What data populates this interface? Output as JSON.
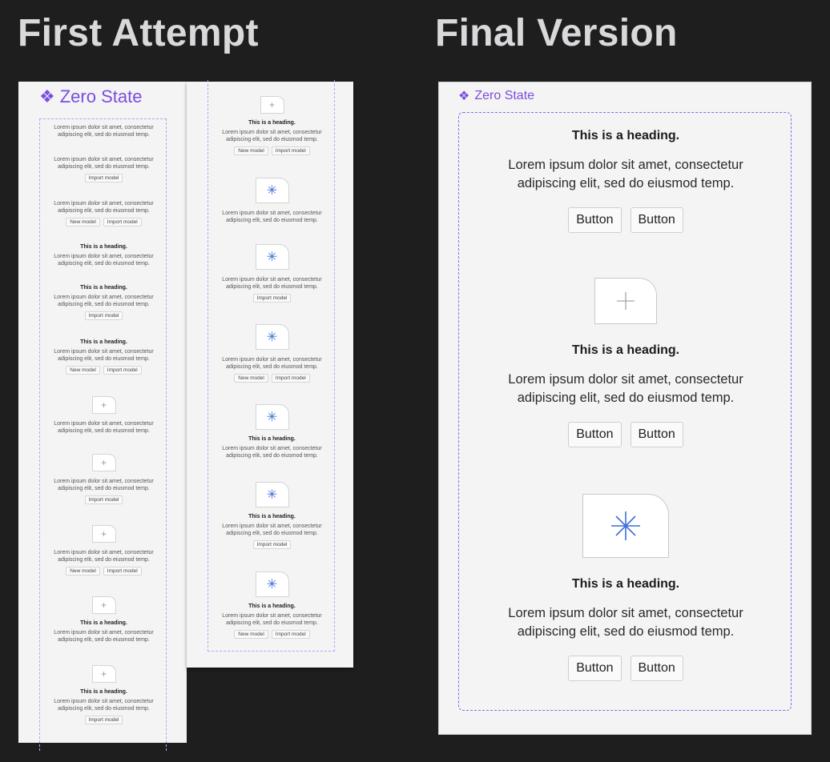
{
  "titles": {
    "left": "First Attempt",
    "right": "Final Version"
  },
  "zero_state": {
    "icon": "❖",
    "label": "Zero State"
  },
  "lorem": {
    "line1": "Lorem ipsum dolor sit amet, consectetur",
    "line2": "adipiscing elit, sed do eiusmod temp."
  },
  "heading": "This is a heading.",
  "mini_buttons": {
    "new": "New model",
    "import": "Import model"
  },
  "final_button": "Button",
  "icons": {
    "plus": "plus-icon",
    "sparkle": "sparkle-icon"
  },
  "colors": {
    "accent": "#7a4ee0",
    "background": "#1e1e1e",
    "icon_blue": "#3d6fd8"
  }
}
